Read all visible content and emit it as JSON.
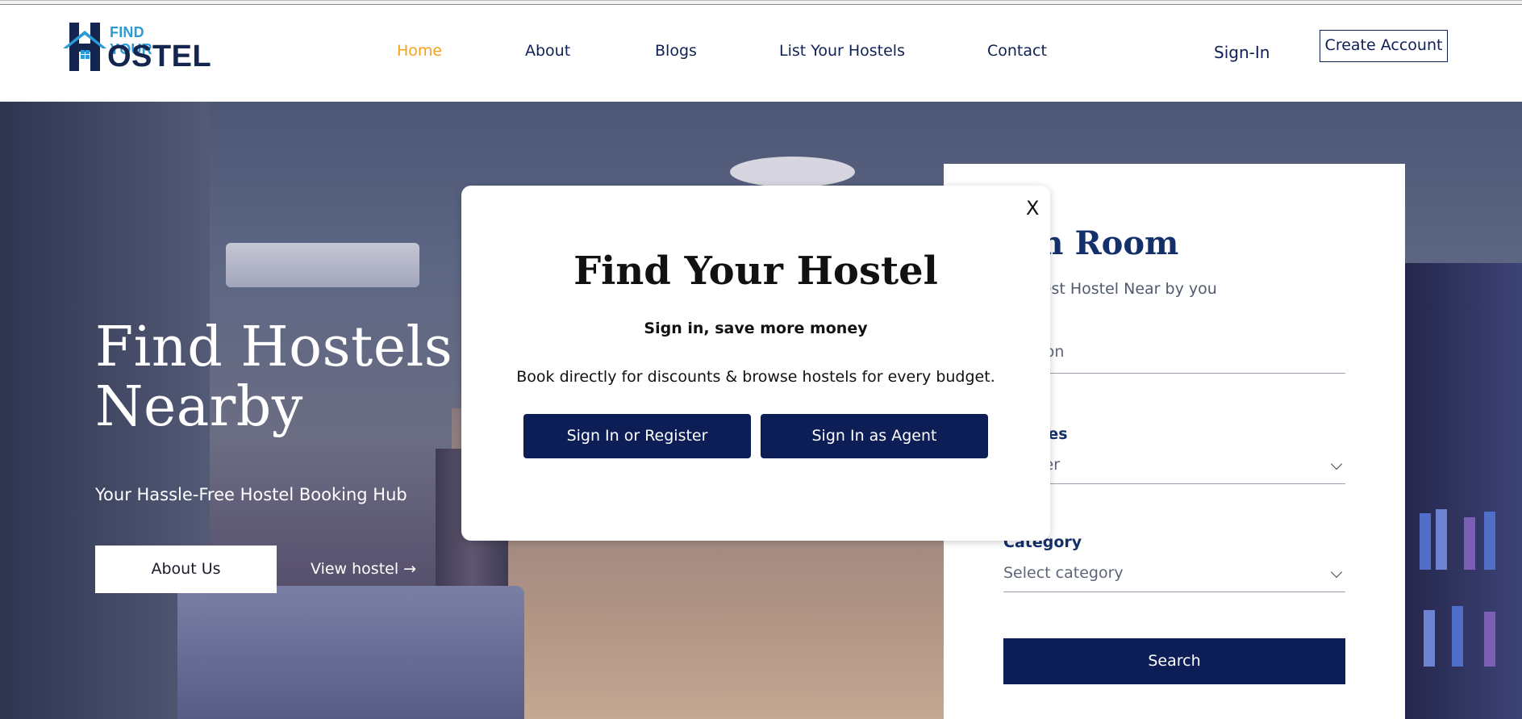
{
  "brand": {
    "top": "FIND YOUR",
    "bottom": "OSTEL",
    "house_letter": "H"
  },
  "nav": {
    "items": [
      "Home",
      "About",
      "Blogs",
      "List Your Hostels",
      "Contact"
    ],
    "active": "Home",
    "signin": "Sign-In",
    "create_account": "Create Account"
  },
  "hero": {
    "title_line1": "Find Hostels",
    "title_line2": "Nearby",
    "subtitle": "Your Hassle-Free Hostel Booking Hub",
    "about_button": "About Us",
    "view_link": "View hostel →"
  },
  "search_card": {
    "title": "rch Room",
    "subtitle": "n Latest Hostel Near by you",
    "location_placeholder": "location",
    "categories_label": "egories",
    "gender_value": "Gender",
    "category_label": "Category",
    "category_value": "Select category",
    "search_button": "Search"
  },
  "modal": {
    "close": "X",
    "title": "Find Your Hostel",
    "subtitle": "Sign in, save more money",
    "description": "Book directly for discounts & browse hostels for every budget.",
    "btn_register": "Sign In or Register",
    "btn_agent": "Sign In as Agent"
  },
  "colors": {
    "navy": "#0d1e57",
    "active_nav": "#f5a11a",
    "brand_blue": "#2b9bd8"
  }
}
